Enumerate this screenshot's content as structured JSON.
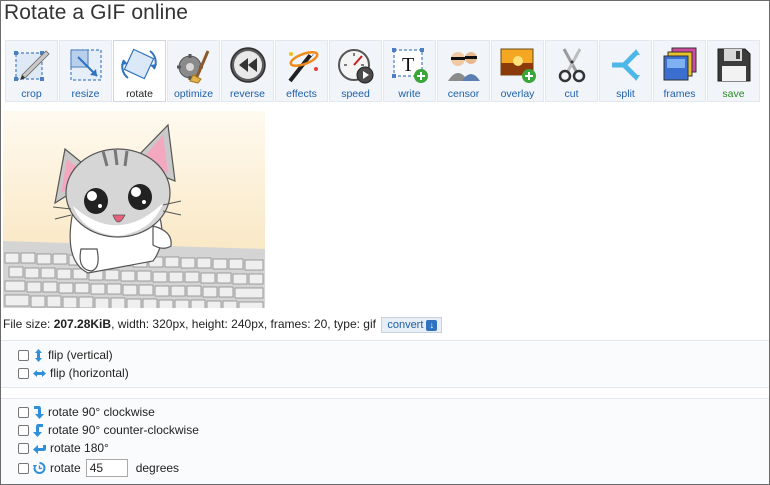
{
  "page": {
    "title": "Rotate a GIF online"
  },
  "toolbar": {
    "items": [
      {
        "label": "crop",
        "icon": "crop-icon"
      },
      {
        "label": "resize",
        "icon": "resize-icon"
      },
      {
        "label": "rotate",
        "icon": "rotate-icon",
        "active": true
      },
      {
        "label": "optimize",
        "icon": "optimize-icon"
      },
      {
        "label": "reverse",
        "icon": "reverse-icon"
      },
      {
        "label": "effects",
        "icon": "effects-icon"
      },
      {
        "label": "speed",
        "icon": "speed-icon"
      },
      {
        "label": "write",
        "icon": "write-icon"
      },
      {
        "label": "censor",
        "icon": "censor-icon"
      },
      {
        "label": "overlay",
        "icon": "overlay-icon"
      },
      {
        "label": "cut",
        "icon": "cut-icon"
      },
      {
        "label": "split",
        "icon": "split-icon"
      },
      {
        "label": "frames",
        "icon": "frames-icon"
      },
      {
        "label": "save",
        "icon": "save-icon"
      }
    ]
  },
  "fileinfo": {
    "size_label": "File size:",
    "size_value": "207.28KiB",
    "width_label": ", width:",
    "width_value": "320px",
    "height_label": ", height:",
    "height_value": "240px",
    "frames_label": ", frames:",
    "frames_value": "20",
    "type_label": ", type:",
    "type_value": "gif",
    "convert_label": "convert"
  },
  "flip": {
    "vertical_label": "flip (vertical)",
    "horizontal_label": "flip (horizontal)"
  },
  "rotate": {
    "cw_label": "rotate 90° clockwise",
    "ccw_label": "rotate 90° counter-clockwise",
    "r180_label": "rotate 180°",
    "custom_label": "rotate",
    "custom_value": "45",
    "degrees_label": "degrees"
  },
  "colors": {
    "link_blue": "#1d5fa8",
    "save_green": "#2a8a22",
    "toolbar_bg": "#f1f5fa",
    "panel_bg": "#fafbfc"
  }
}
